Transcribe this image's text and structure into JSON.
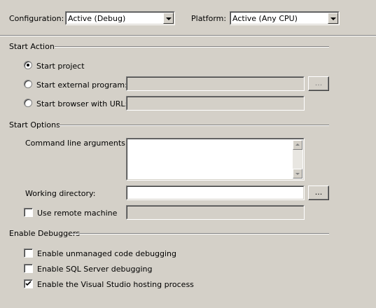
{
  "header": {
    "configuration_label": "Configuration:",
    "configuration_value": "Active (Debug)",
    "platform_label": "Platform:",
    "platform_value": "Active (Any CPU)"
  },
  "start_action": {
    "title": "Start Action",
    "options": [
      {
        "label": "Start project",
        "selected": true
      },
      {
        "label": "Start external program:",
        "selected": false
      },
      {
        "label": "Start browser with URL:",
        "selected": false
      }
    ],
    "browse_button": "...",
    "external_program_value": "",
    "browser_url_value": ""
  },
  "start_options": {
    "title": "Start Options",
    "command_line_label": "Command line arguments:",
    "command_line_value": "",
    "working_directory_label": "Working directory:",
    "working_directory_value": "",
    "browse_button": "...",
    "remote_machine_label": "Use remote machine",
    "remote_machine_checked": false,
    "remote_machine_value": ""
  },
  "enable_debuggers": {
    "title": "Enable Debuggers",
    "items": [
      {
        "label": "Enable unmanaged code debugging",
        "checked": false
      },
      {
        "label": "Enable SQL Server debugging",
        "checked": false
      },
      {
        "label": "Enable the Visual Studio hosting process",
        "checked": true
      }
    ]
  },
  "colors": {
    "window_bg": "#d4d0c8",
    "field_bg": "#ffffff",
    "shadow": "#808080",
    "disabled_text": "#808080"
  }
}
